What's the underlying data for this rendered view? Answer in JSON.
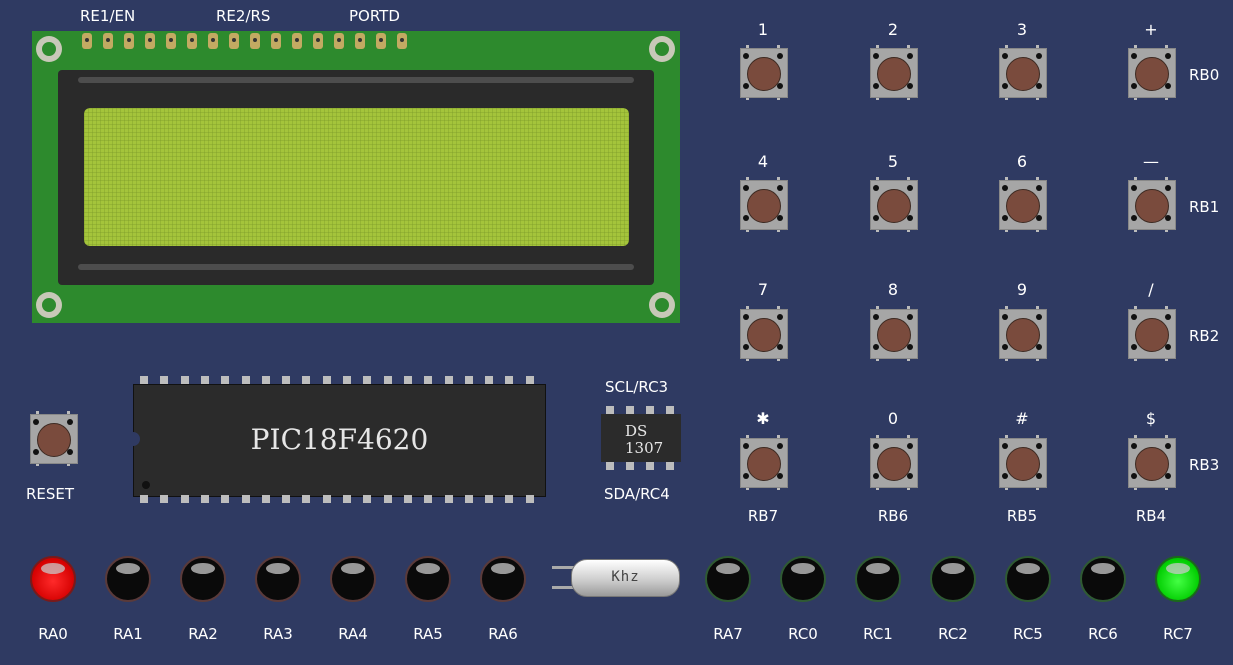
{
  "lcd": {
    "header_labels": [
      "RE1/EN",
      "RE2/RS",
      "PORTD"
    ]
  },
  "keypad": {
    "keys": [
      "1",
      "2",
      "3",
      "+",
      "4",
      "5",
      "6",
      "—",
      "7",
      "8",
      "9",
      "/",
      "✱",
      "0",
      "#",
      "$"
    ],
    "row_labels": [
      "RB0",
      "RB1",
      "RB2",
      "RB3"
    ],
    "col_labels": [
      "RB7",
      "RB6",
      "RB5",
      "RB4"
    ]
  },
  "reset": {
    "label": "RESET"
  },
  "chips": {
    "pic": "PIC18F4620",
    "ds_line1": "DS",
    "ds_line2": "1307",
    "scl_label": "SCL/RC3",
    "sda_label": "SDA/RC4"
  },
  "crystal": {
    "label": "Khz"
  },
  "leds": [
    {
      "label": "RA0",
      "state": "on",
      "color": "#ff0000"
    },
    {
      "label": "RA1",
      "state": "off"
    },
    {
      "label": "RA2",
      "state": "off"
    },
    {
      "label": "RA3",
      "state": "off"
    },
    {
      "label": "RA4",
      "state": "off"
    },
    {
      "label": "RA5",
      "state": "off"
    },
    {
      "label": "RA6",
      "state": "off"
    },
    {
      "label": "RA7",
      "state": "off"
    },
    {
      "label": "RC0",
      "state": "off"
    },
    {
      "label": "RC1",
      "state": "off"
    },
    {
      "label": "RC2",
      "state": "off"
    },
    {
      "label": "RC5",
      "state": "off"
    },
    {
      "label": "RC6",
      "state": "off"
    },
    {
      "label": "RC7",
      "state": "on",
      "color": "#00ff00"
    }
  ],
  "colors": {
    "background": "#2f3a62",
    "pcb": "#2d8a2d",
    "lcd_screen": "#a4c43b"
  }
}
